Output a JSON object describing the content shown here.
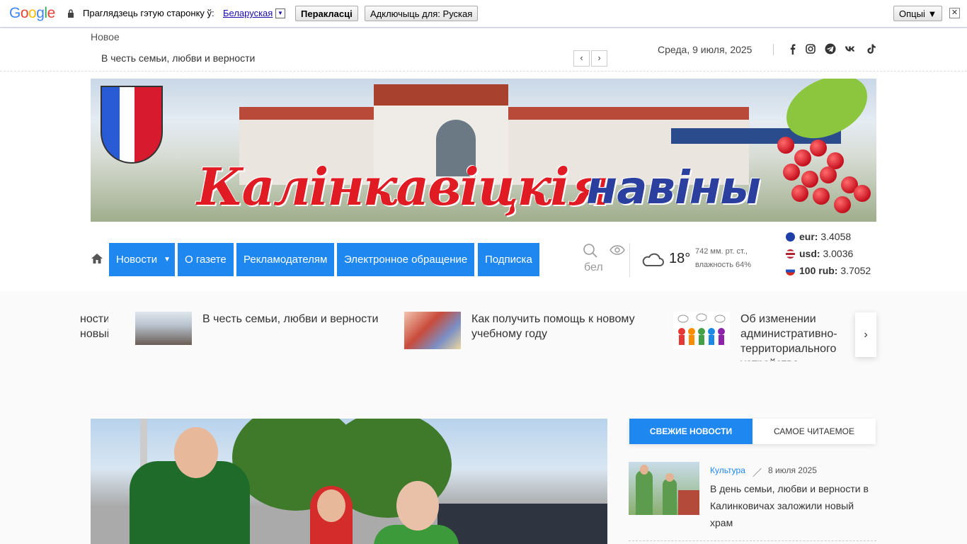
{
  "translate_bar": {
    "logo": "Google",
    "prompt": "Праглядзець гэтую старонку ў:",
    "language": "Беларуская",
    "translate_button": "Перакласці",
    "disable_button": "Адключыць для: Руская",
    "options_button": "Опцыі ▼",
    "close": "✕"
  },
  "top_strip": {
    "ticker_label": "Новое",
    "ticker_text": "В честь семьи, любви и верности",
    "date": "Среда, 9 июля, 2025",
    "socials": [
      "facebook-icon",
      "instagram-icon",
      "telegram-icon",
      "vk-icon",
      "tiktok-icon"
    ]
  },
  "banner": {
    "title_main": "Калінкавіцкія",
    "title_second": "навіны"
  },
  "nav": {
    "items": [
      {
        "label": "Новости",
        "has_dropdown": true
      },
      {
        "label": "О газете"
      },
      {
        "label": "Рекламодателям"
      },
      {
        "label": "Электронное обращение"
      },
      {
        "label": "Подписка"
      }
    ],
    "lang": "бел"
  },
  "weather": {
    "temp": "18°",
    "pressure": "742 мм. рт. ст.,",
    "humidity": "влажность 64%"
  },
  "rates": [
    {
      "code": "eur:",
      "value": "3.4058"
    },
    {
      "code": "usd:",
      "value": "3.0036"
    },
    {
      "code": "100 rub:",
      "value": "3.7052"
    }
  ],
  "carousel": {
    "partial_left": "ности\nновый",
    "items": [
      {
        "title": "В честь семьи, любви и верности"
      },
      {
        "title": "Как получить помощь к новому учебному году"
      },
      {
        "title": "Об изменении административно-территориального устройства Калинковичского района"
      }
    ],
    "next": "›"
  },
  "sidebar": {
    "tab_fresh": "СВЕЖИЕ НОВОСТИ",
    "tab_popular": "САМОЕ ЧИТАЕМОЕ",
    "news": {
      "category": "Культура",
      "date": "8 июля 2025",
      "title": "В день семьи, любви и верности в Калинковичах заложили новый храм"
    }
  },
  "colors": {
    "accent": "#1f87f0",
    "title_red": "#e01b24",
    "title_blue": "#2b3f9e"
  }
}
